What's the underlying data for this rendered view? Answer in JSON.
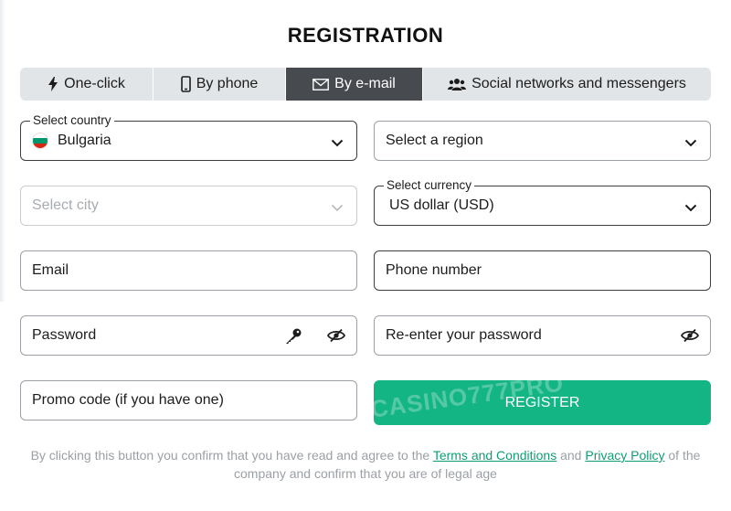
{
  "title": "REGISTRATION",
  "tabs": [
    {
      "label": "One-click",
      "icon": "lightning-icon",
      "active": false
    },
    {
      "label": "By phone",
      "icon": "phone-icon",
      "active": false
    },
    {
      "label": "By e-mail",
      "icon": "envelope-icon",
      "active": true
    },
    {
      "label": "Social networks and messengers",
      "icon": "users-icon",
      "active": false
    }
  ],
  "country": {
    "label": "Select country",
    "value": "Bulgaria",
    "flag_colors": [
      "#ffffff",
      "#00966e",
      "#d62612"
    ]
  },
  "region": {
    "placeholder": "Select a region"
  },
  "city": {
    "placeholder": "Select city"
  },
  "currency": {
    "label": "Select currency",
    "value": "US dollar (USD)"
  },
  "email": {
    "placeholder": "Email"
  },
  "phone": {
    "placeholder": "Phone number"
  },
  "password": {
    "placeholder": "Password"
  },
  "password_confirm": {
    "placeholder": "Re-enter your password"
  },
  "promo": {
    "placeholder": "Promo code (if you have one)"
  },
  "register": {
    "label": "REGISTER",
    "color": "#14b584"
  },
  "watermark": "CASINO777PRO",
  "consent": {
    "before": "By clicking this button you confirm that you have read and agree to the",
    "terms": "Terms and Conditions",
    "and": "and",
    "privacy": "Privacy Policy",
    "after": "of the company and confirm that you are of legal age"
  }
}
